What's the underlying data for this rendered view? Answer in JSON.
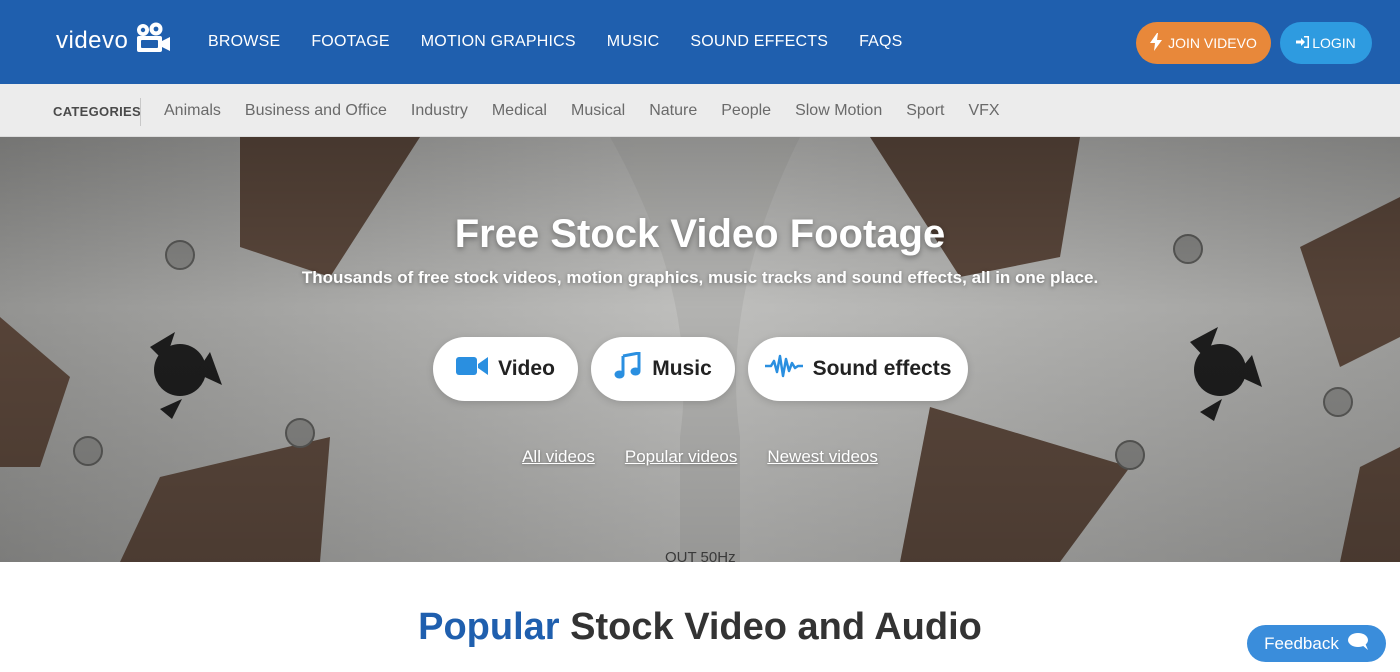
{
  "header": {
    "logo_text": "videvo",
    "nav": [
      "BROWSE",
      "FOOTAGE",
      "MOTION GRAPHICS",
      "MUSIC",
      "SOUND EFFECTS",
      "FAQS"
    ],
    "join_label": "JOIN VIDEVO",
    "login_label": "LOGIN"
  },
  "categories": {
    "label": "CATEGORIES",
    "items": [
      "Animals",
      "Business and Office",
      "Industry",
      "Medical",
      "Musical",
      "Nature",
      "People",
      "Slow Motion",
      "Sport",
      "VFX"
    ]
  },
  "hero": {
    "title": "Free Stock Video Footage",
    "subtitle": "Thousands of free stock videos, motion graphics, music tracks and sound effects, all in one place.",
    "buttons": {
      "video": "Video",
      "music": "Music",
      "sound": "Sound effects"
    },
    "links": [
      "All videos",
      "Popular videos",
      "Newest videos"
    ],
    "bg_text": "OUT 50Hz"
  },
  "section": {
    "highlight": "Popular",
    "rest": "Stock Video and Audio"
  },
  "feedback_label": "Feedback",
  "colors": {
    "nav_bg": "#1f5fae",
    "join": "#e8883a",
    "login": "#2e9be0",
    "accent_icon": "#2a8fe0"
  }
}
